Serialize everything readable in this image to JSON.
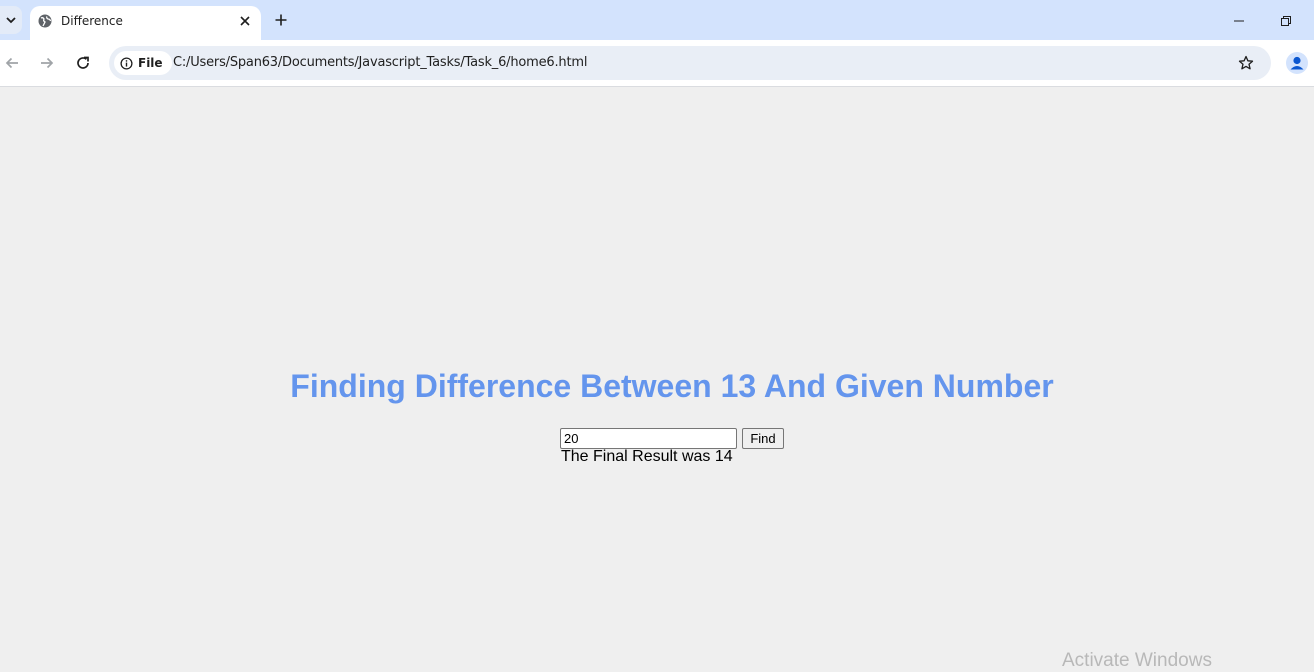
{
  "browser": {
    "tab": {
      "title": "Difference"
    },
    "address_bar": {
      "site_chip_label": "File",
      "url": "C:/Users/Span63/Documents/Javascript_Tasks/Task_6/home6.html"
    },
    "icons": {
      "tab_search": "chevron-down-icon",
      "favicon": "globe-icon",
      "close": "close-icon",
      "new_tab": "plus-icon",
      "minimize": "minimize-icon",
      "restore": "restore-icon",
      "back": "back-arrow-icon",
      "forward": "forward-arrow-icon",
      "reload": "reload-icon",
      "info": "info-icon",
      "bookmark": "star-icon",
      "profile": "profile-icon"
    },
    "colors": {
      "tabstrip": "#d3e3fd",
      "omnibox": "#e9eef6",
      "profile_accent": "#0b57d0"
    }
  },
  "page": {
    "heading": "Finding Difference Between 13 And Given Number",
    "heading_color": "#6495ed",
    "number_input_value": "20",
    "find_button_label": "Find",
    "result_text": "The Final Result was 14"
  },
  "os_overlay": {
    "watermark": "Activate Windows"
  }
}
